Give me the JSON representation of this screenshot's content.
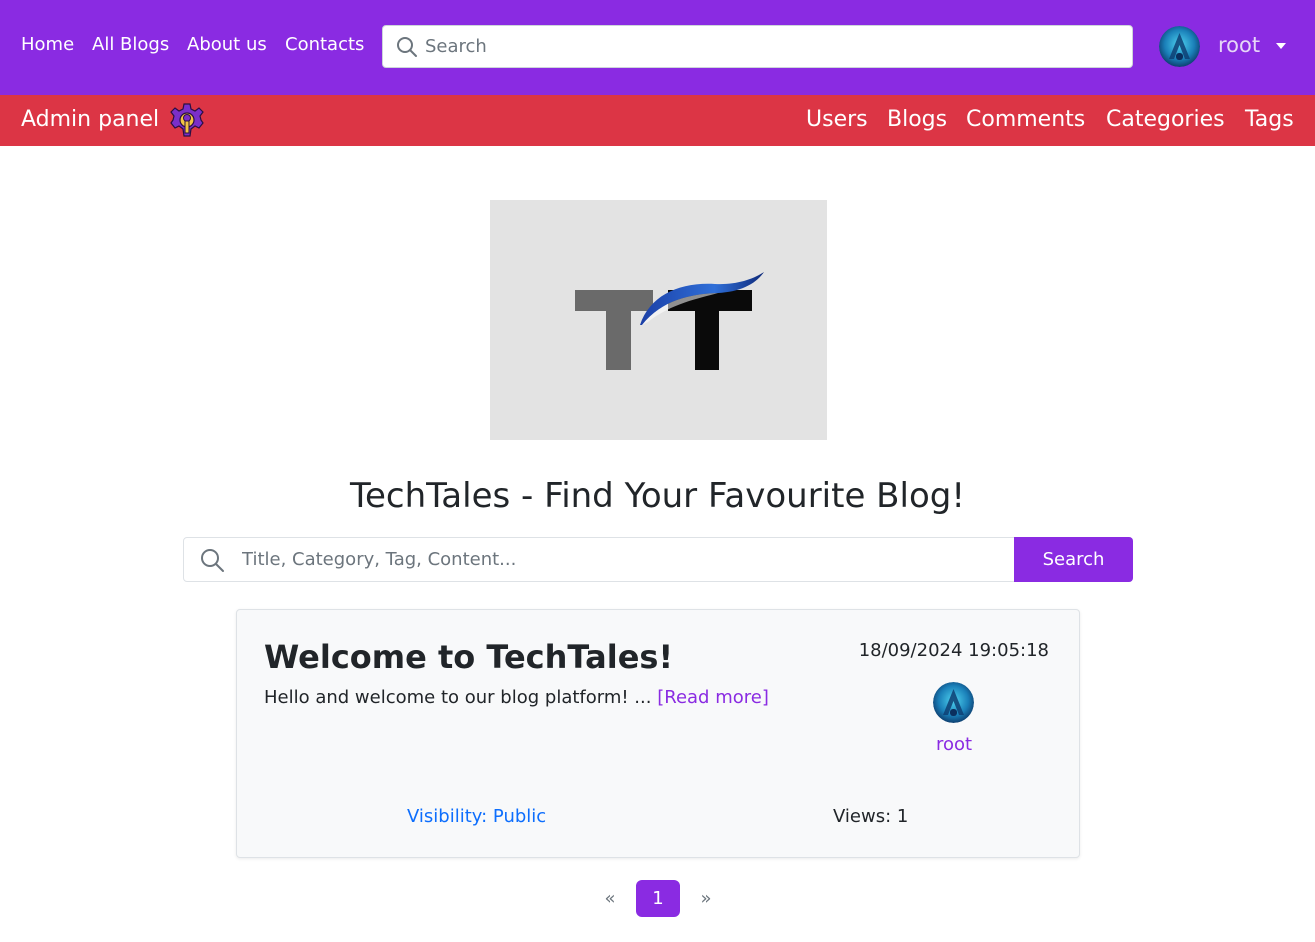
{
  "nav": {
    "links": [
      "Home",
      "All Blogs",
      "About us",
      "Contacts"
    ],
    "search_placeholder": "Search",
    "username": "root"
  },
  "admin": {
    "title": "Admin panel",
    "links": [
      "Users",
      "Blogs",
      "Comments",
      "Categories",
      "Tags"
    ]
  },
  "site_title": "TechTales - Find Your Favourite Blog!",
  "blog_search": {
    "placeholder": "Title, Category, Tag, Content...",
    "button": "Search"
  },
  "post": {
    "title": "Welcome to TechTales!",
    "excerpt": "Hello and welcome to our blog platform!  ...",
    "read_more": "[Read more]",
    "date": "18/09/2024 19:05:18",
    "author": "root",
    "visibility": "Visibility: Public",
    "views": "Views: 1"
  },
  "pagination": {
    "prev": "«",
    "current": "1",
    "next": "»"
  },
  "colors": {
    "primary": "#8a2be2",
    "admin_bar": "#dc3545",
    "link_blue": "#0d6efd"
  },
  "icons": {
    "search": "search-icon",
    "admin": "gear-wrench-icon",
    "avatar": "avatar"
  }
}
